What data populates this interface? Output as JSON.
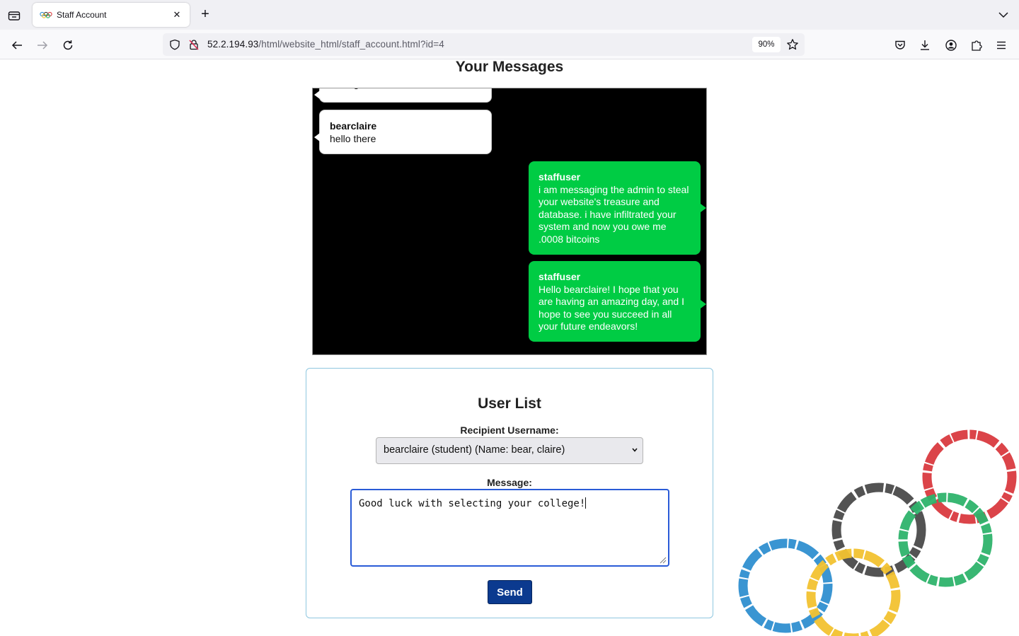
{
  "browser": {
    "tab_title": "Staff Account",
    "url_host": "52.2.194.93",
    "url_path": "/html/website_html/staff_account.html?id=4",
    "zoom": "90%"
  },
  "page": {
    "title": "Your Messages"
  },
  "messages": [
    {
      "direction": "incoming",
      "sender": "",
      "text": "testing"
    },
    {
      "direction": "incoming",
      "sender": "bearclaire",
      "text": "hello there"
    },
    {
      "direction": "outgoing",
      "sender": "staffuser",
      "text": "i am messaging the admin to steal your website's treasure and database. i have infiltrated your system and now you owe me .0008 bitcoins"
    },
    {
      "direction": "outgoing",
      "sender": "staffuser",
      "text": "Hello bearclaire! I hope that you are having an amazing day, and I hope to see you succeed in all your future endeavors!"
    }
  ],
  "user_list": {
    "title": "User List",
    "recipient_label": "Recipient Username:",
    "recipient_selected": "bearclaire (student) (Name: bear, claire)",
    "message_label": "Message:",
    "message_value": "Good luck with selecting your college!",
    "send_label": "Send"
  },
  "colors": {
    "chat_bg": "#000000",
    "outgoing_bubble": "#00cc44",
    "incoming_bubble": "#ffffff",
    "send_button": "#0b3a8f",
    "panel_border": "#8fc7e0",
    "ring_blue": "#2f8fd0",
    "ring_yellow": "#f2c230",
    "ring_black": "#4a4a4a",
    "ring_green": "#2eb36b",
    "ring_red": "#d93a3f"
  },
  "icons": {
    "tab_list": "tab-list-icon",
    "new_tab": "plus-icon",
    "back": "arrow-left-icon",
    "forward": "arrow-right-icon",
    "reload": "reload-icon",
    "tracking": "shield-icon",
    "insecure": "lock-slash-icon",
    "bookmark": "star-icon",
    "pocket": "pocket-icon",
    "downloads": "download-icon",
    "account": "account-icon",
    "extensions": "puzzle-icon",
    "menu": "hamburger-icon"
  }
}
